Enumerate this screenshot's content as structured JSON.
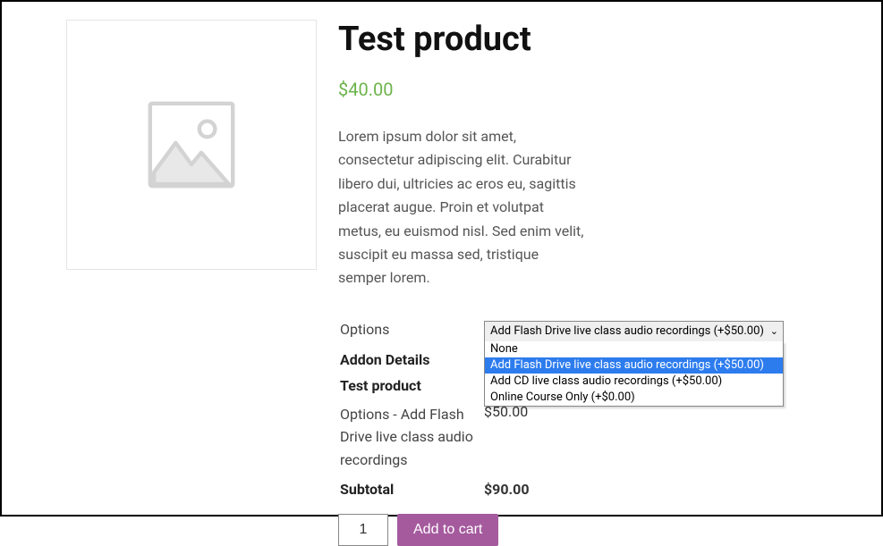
{
  "product": {
    "title": "Test product",
    "price": "$40.00",
    "description": "Lorem ipsum dolor sit amet, consectetur adipiscing elit. Curabitur libero dui, ultricies ac eros eu, sagittis placerat augue. Proin et volutpat metus, eu euismod nisl. Sed enim velit, suscipit eu massa sed, tristique semper lorem."
  },
  "addons": {
    "options_label": "Options",
    "details_heading": "Addon Details",
    "product_name": "Test product",
    "selected_option_text": "Options - Add Flash Drive live class audio recordings",
    "selected_option_price": "$50.00",
    "subtotal_label": "Subtotal",
    "subtotal_price": "$90.00"
  },
  "select": {
    "display": "Add Flash Drive live class audio recordings (+$50.00)",
    "options": [
      "None",
      "Add Flash Drive live class audio recordings (+$50.00)",
      "Add CD live class audio recordings (+$50.00)",
      "Online Course Only (+$0.00)"
    ],
    "highlighted_index": 1
  },
  "cart": {
    "quantity": "1",
    "button_label": "Add to cart"
  }
}
